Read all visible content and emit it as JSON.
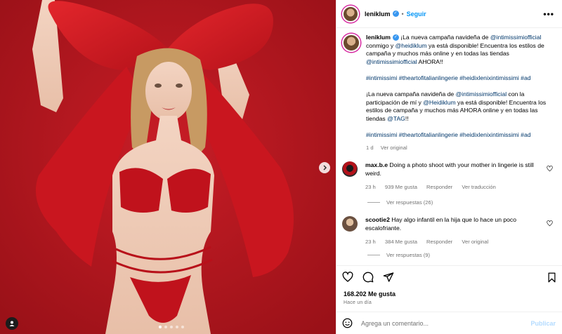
{
  "post": {
    "username": "leniklum",
    "follow_label": "Seguir",
    "separator": "•",
    "caption": {
      "username": "leniklum",
      "para1_prefix": " ¡La nueva campaña navideña de ",
      "mention1": "@intimissimiofficial",
      "para1_mid": " conmigo y ",
      "mention2": "@heidiklum",
      "para1_mid2": " ya está disponible! Encuentra los estilos de campaña y muchos más online y en todas las tiendas ",
      "mention3": "@intimissimiofficial",
      "para1_suffix": " AHORA!!",
      "hashtags1": "#intimissimi #theartofitalianlingerie #heidixlenixintimissimi #ad",
      "para2_prefix": "¡La nueva campaña navideña de ",
      "mention4": "@intimissimiofficial",
      "para2_mid": " con la participación de mí y ",
      "mention5": "@Heidiklum",
      "para2_mid2": " ya está disponible! Encuentra los estilos de campaña y muchos más AHORA online y en todas las tiendas ",
      "mention6": "@TAG",
      "para2_suffix": "!!",
      "hashtags2": "#intimissimi #theartofitalianlingerie #heidixlenixintimissimi #ad",
      "age": "1 d",
      "see_original": "Ver original"
    },
    "comments": [
      {
        "username": "max.b.e",
        "text": " Doing a photo shoot with your mother in lingerie is still weird.",
        "age": "23 h",
        "likes": "939 Me gusta",
        "reply": "Responder",
        "translate": "Ver traducción",
        "view_replies": "Ver respuestas (26)"
      },
      {
        "username": "scootie2",
        "text": " Hay algo infantil en la hija que lo hace un poco escalofriante.",
        "age": "23 h",
        "likes": "384 Me gusta",
        "reply": "Responder",
        "translate": "Ver original",
        "view_replies": "Ver respuestas (9)"
      }
    ],
    "likes_count": "168.202 Me gusta",
    "posted_time": "Hace un día",
    "comment_placeholder": "Agrega un comentario...",
    "publish_label": "Publicar"
  },
  "carousel": {
    "total_slides": 5,
    "active_slide": 1
  },
  "colors": {
    "accent": "#0095f6",
    "link": "#00376b",
    "bow_red": "#d21a22",
    "bg_red": "#b8151e"
  },
  "icons": [
    "heart-icon",
    "comment-icon",
    "share-icon",
    "bookmark-icon",
    "more-icon",
    "verified-icon",
    "emoji-icon",
    "chevron-right-icon",
    "user-tag-icon"
  ]
}
